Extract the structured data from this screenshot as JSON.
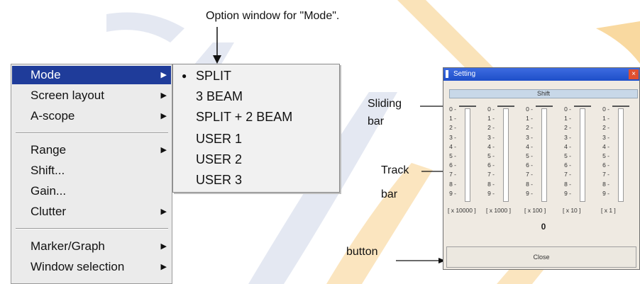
{
  "caption": "Option window for \"Mode\".",
  "menu": {
    "items": [
      {
        "label": "Mode",
        "submenu": true,
        "active": true
      },
      {
        "label": "Screen layout",
        "submenu": true
      },
      {
        "label": "A-scope",
        "submenu": true
      },
      {
        "label": "Range",
        "submenu": true
      },
      {
        "label": "Shift...",
        "submenu": false
      },
      {
        "label": "Gain...",
        "submenu": false
      },
      {
        "label": "Clutter",
        "submenu": true
      },
      {
        "label": "Marker/Graph",
        "submenu": true
      },
      {
        "label": "Window selection",
        "submenu": true
      }
    ]
  },
  "submenu": {
    "items": [
      {
        "label": "SPLIT",
        "selected": true
      },
      {
        "label": "3 BEAM"
      },
      {
        "label": "SPLIT + 2 BEAM"
      },
      {
        "label": "USER 1"
      },
      {
        "label": "USER 2"
      },
      {
        "label": "USER 3"
      }
    ]
  },
  "settings_window": {
    "title": "Setting",
    "close_glyph": "×",
    "shift_label": "Shift",
    "tick_numbers": [
      "0",
      "1",
      "2",
      "3",
      "4",
      "5",
      "6",
      "7",
      "8",
      "9"
    ],
    "multipliers": [
      "[ x 10000 ]",
      "[ x 1000 ]",
      "[ x 100 ]",
      "[ x 10 ]",
      "[ x 1 ]"
    ],
    "value": "0",
    "close_button": "Close"
  },
  "annotations": {
    "sliding": "Sliding",
    "sliding_bar": "bar",
    "track": "Track",
    "track_bar": "bar",
    "button": "button"
  },
  "colors": {
    "menu_highlight": "#1f3c9a",
    "watermark_orange": "#f6c36a",
    "watermark_blue": "#d5dceb"
  },
  "icons": [
    "submenu-arrow-icon",
    "selected-bullet-icon",
    "window-close-icon"
  ]
}
